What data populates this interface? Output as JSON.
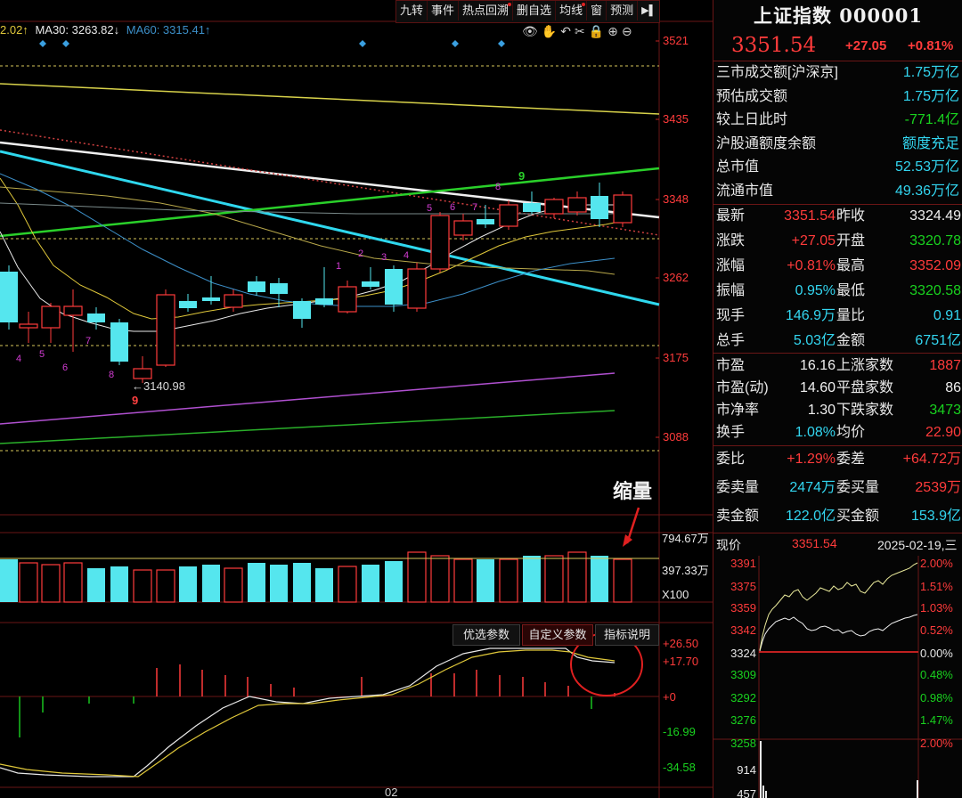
{
  "toolbar": {
    "items": [
      "九转",
      "事件",
      "热点回溯",
      "删自选",
      "均线",
      "窗",
      "预测"
    ],
    "exit_icon": "exit-icon"
  },
  "ma_legend": {
    "ma_partial": "2.02↑",
    "ma30": "MA30: 3263.82↓",
    "ma60": "MA60: 3315.41↑"
  },
  "chart_icons": [
    "eye-icon",
    "hand-icon",
    "undo-icon",
    "scissors-icon",
    "lock-icon",
    "zoom-in-icon",
    "zoom-out-icon"
  ],
  "main_axis": {
    "labels": [
      "3521",
      "3435",
      "3348",
      "3262",
      "3175",
      "3088"
    ]
  },
  "volume_axis": {
    "labels": [
      "794.67万",
      "397.33万",
      "X100"
    ]
  },
  "macd_axis": {
    "labels": [
      "+26.50",
      "+17.70",
      "+0",
      "-16.99",
      "-34.58"
    ]
  },
  "annotations": {
    "low_label": "←3140.98",
    "shrink_label": "缩量",
    "date_tick": "02"
  },
  "nine_counts": {
    "green": [
      "4",
      "5",
      "6",
      "7",
      "8",
      "9"
    ],
    "magenta": [
      "1",
      "2",
      "3",
      "4",
      "5",
      "6",
      "7",
      "8",
      "9"
    ]
  },
  "params": {
    "optimal": "优选参数",
    "custom": "自定义参数",
    "help": "指标说明"
  },
  "panel": {
    "title": "上证指数 000001",
    "price": "3351.54",
    "change": "+27.05",
    "change_pct": "+0.81%",
    "info": [
      {
        "label": "三市成交额[沪深京]",
        "value": "1.75万亿"
      },
      {
        "label": "预估成交额",
        "value": "1.75万亿"
      },
      {
        "label": "较上日此时",
        "value": "-771.4亿"
      },
      {
        "label": "沪股通额度余额",
        "value": "额度充足"
      },
      {
        "label": "总市值",
        "value": "52.53万亿"
      },
      {
        "label": "流通市值",
        "value": "49.36万亿"
      }
    ],
    "quote": [
      {
        "a": "最新",
        "b": "3351.54",
        "c": "昨收",
        "d": "3324.49"
      },
      {
        "a": "涨跌",
        "b": "+27.05",
        "c": "开盘",
        "d": "3320.78"
      },
      {
        "a": "涨幅",
        "b": "+0.81%",
        "c": "最高",
        "d": "3352.09"
      },
      {
        "a": "振幅",
        "b": "0.95%",
        "c": "最低",
        "d": "3320.58"
      },
      {
        "a": "现手",
        "b": "146.9万",
        "c": "量比",
        "d": "0.91"
      },
      {
        "a": "总手",
        "b": "5.03亿",
        "c": "金额",
        "d": "6751亿"
      }
    ],
    "valuation": [
      {
        "a": "市盈",
        "b": "16.16",
        "c": "上涨家数",
        "d": "1887"
      },
      {
        "a": "市盈(动)",
        "b": "14.60",
        "c": "平盘家数",
        "d": "86"
      },
      {
        "a": "市净率",
        "b": "1.30",
        "c": "下跌家数",
        "d": "3473"
      },
      {
        "a": "换手",
        "b": "1.08%",
        "c": "均价",
        "d": "22.90"
      }
    ],
    "orders": [
      {
        "a": "委比",
        "b": "+1.29%",
        "c": "委差",
        "d": "+64.72万"
      },
      {
        "a": "委卖量",
        "b": "2474万",
        "c": "委买量",
        "d": "2539万"
      },
      {
        "a": "卖金额",
        "b": "122.0亿",
        "c": "买金额",
        "d": "153.9亿"
      }
    ],
    "mini": {
      "header_label": "现价",
      "header_price": "3351.54",
      "header_date": "2025-02-19,三",
      "left_labels": [
        "3391",
        "3375",
        "3359",
        "3342",
        "3324",
        "3309",
        "3292",
        "3276",
        "3258"
      ],
      "right_labels": [
        "2.00%",
        "1.51%",
        "1.03%",
        "0.52%",
        "0.00%",
        "0.48%",
        "0.98%",
        "1.47%",
        "2.00%"
      ],
      "vol_labels": [
        "914",
        "457"
      ]
    }
  },
  "colors": {
    "up": "#ff3b3b",
    "down": "#55e6ee",
    "grid": "#5a1212"
  }
}
